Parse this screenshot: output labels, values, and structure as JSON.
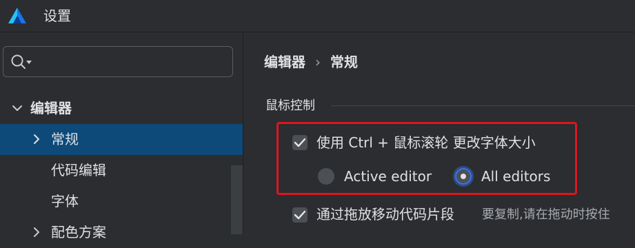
{
  "window": {
    "title": "设置"
  },
  "sidebar": {
    "search": {
      "value": "",
      "placeholder": ""
    },
    "tree": [
      {
        "label": "编辑器",
        "expanded": true
      },
      {
        "label": "常规",
        "selected": true
      },
      {
        "label": "代码编辑"
      },
      {
        "label": "字体"
      },
      {
        "label": "配色方案"
      }
    ]
  },
  "main": {
    "breadcrumb": [
      "编辑器",
      "常规"
    ],
    "section": "鼠标控制",
    "options": {
      "ctrl_wheel": {
        "label": "使用 Ctrl + 鼠标滚轮 更改字体大小",
        "checked": true
      },
      "radio_active": {
        "label": "Active editor",
        "checked": false
      },
      "radio_all": {
        "label": "All editors",
        "checked": true
      },
      "drag_drop": {
        "label": "通过拖放移动代码片段",
        "checked": true,
        "hint": "要复制,请在拖动时按住"
      }
    }
  },
  "colors": {
    "background": "#2b2d30",
    "selection": "#0d4a7a",
    "accent": "#3574f0",
    "highlight_border": "#e0141e"
  }
}
